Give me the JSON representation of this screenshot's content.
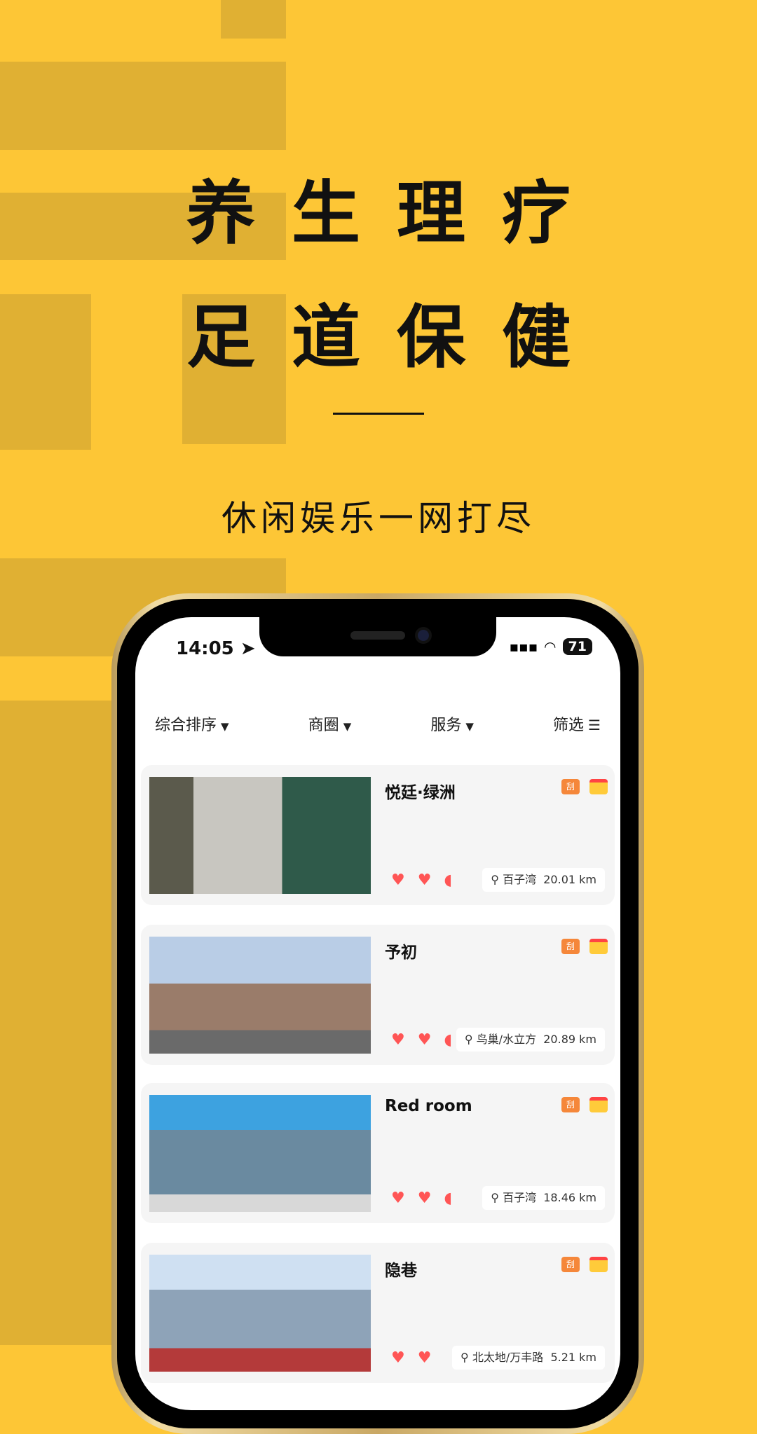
{
  "hero": {
    "line1": "养生理疗",
    "line2": "足道保健",
    "subtitle": "休闲娱乐一网打尽"
  },
  "colors": {
    "background": "#fdc636",
    "accent": "#f5873a",
    "heart": "#ff5555"
  },
  "status": {
    "time": "14:05",
    "battery": "71"
  },
  "filters": [
    {
      "label": "综合排序",
      "icon": "triangle-down"
    },
    {
      "label": "商圈",
      "icon": "triangle-down"
    },
    {
      "label": "服务",
      "icon": "triangle-down"
    },
    {
      "label": "筛选",
      "icon": "filter-lines"
    }
  ],
  "shops": [
    {
      "name": "悦廷·绿洲",
      "area": "百子湾",
      "distance": "20.01 km"
    },
    {
      "name": "予初",
      "area": "鸟巢/水立方",
      "distance": "20.89 km"
    },
    {
      "name": "Red room",
      "area": "百子湾",
      "distance": "18.46 km"
    },
    {
      "name": "隐巷",
      "area": "北太地/万丰路",
      "distance": "5.21 km"
    }
  ],
  "badges": {
    "scratch": "刮"
  },
  "icons": {
    "heart": "♥",
    "pin": "⌾",
    "gift": "gift-icon"
  }
}
